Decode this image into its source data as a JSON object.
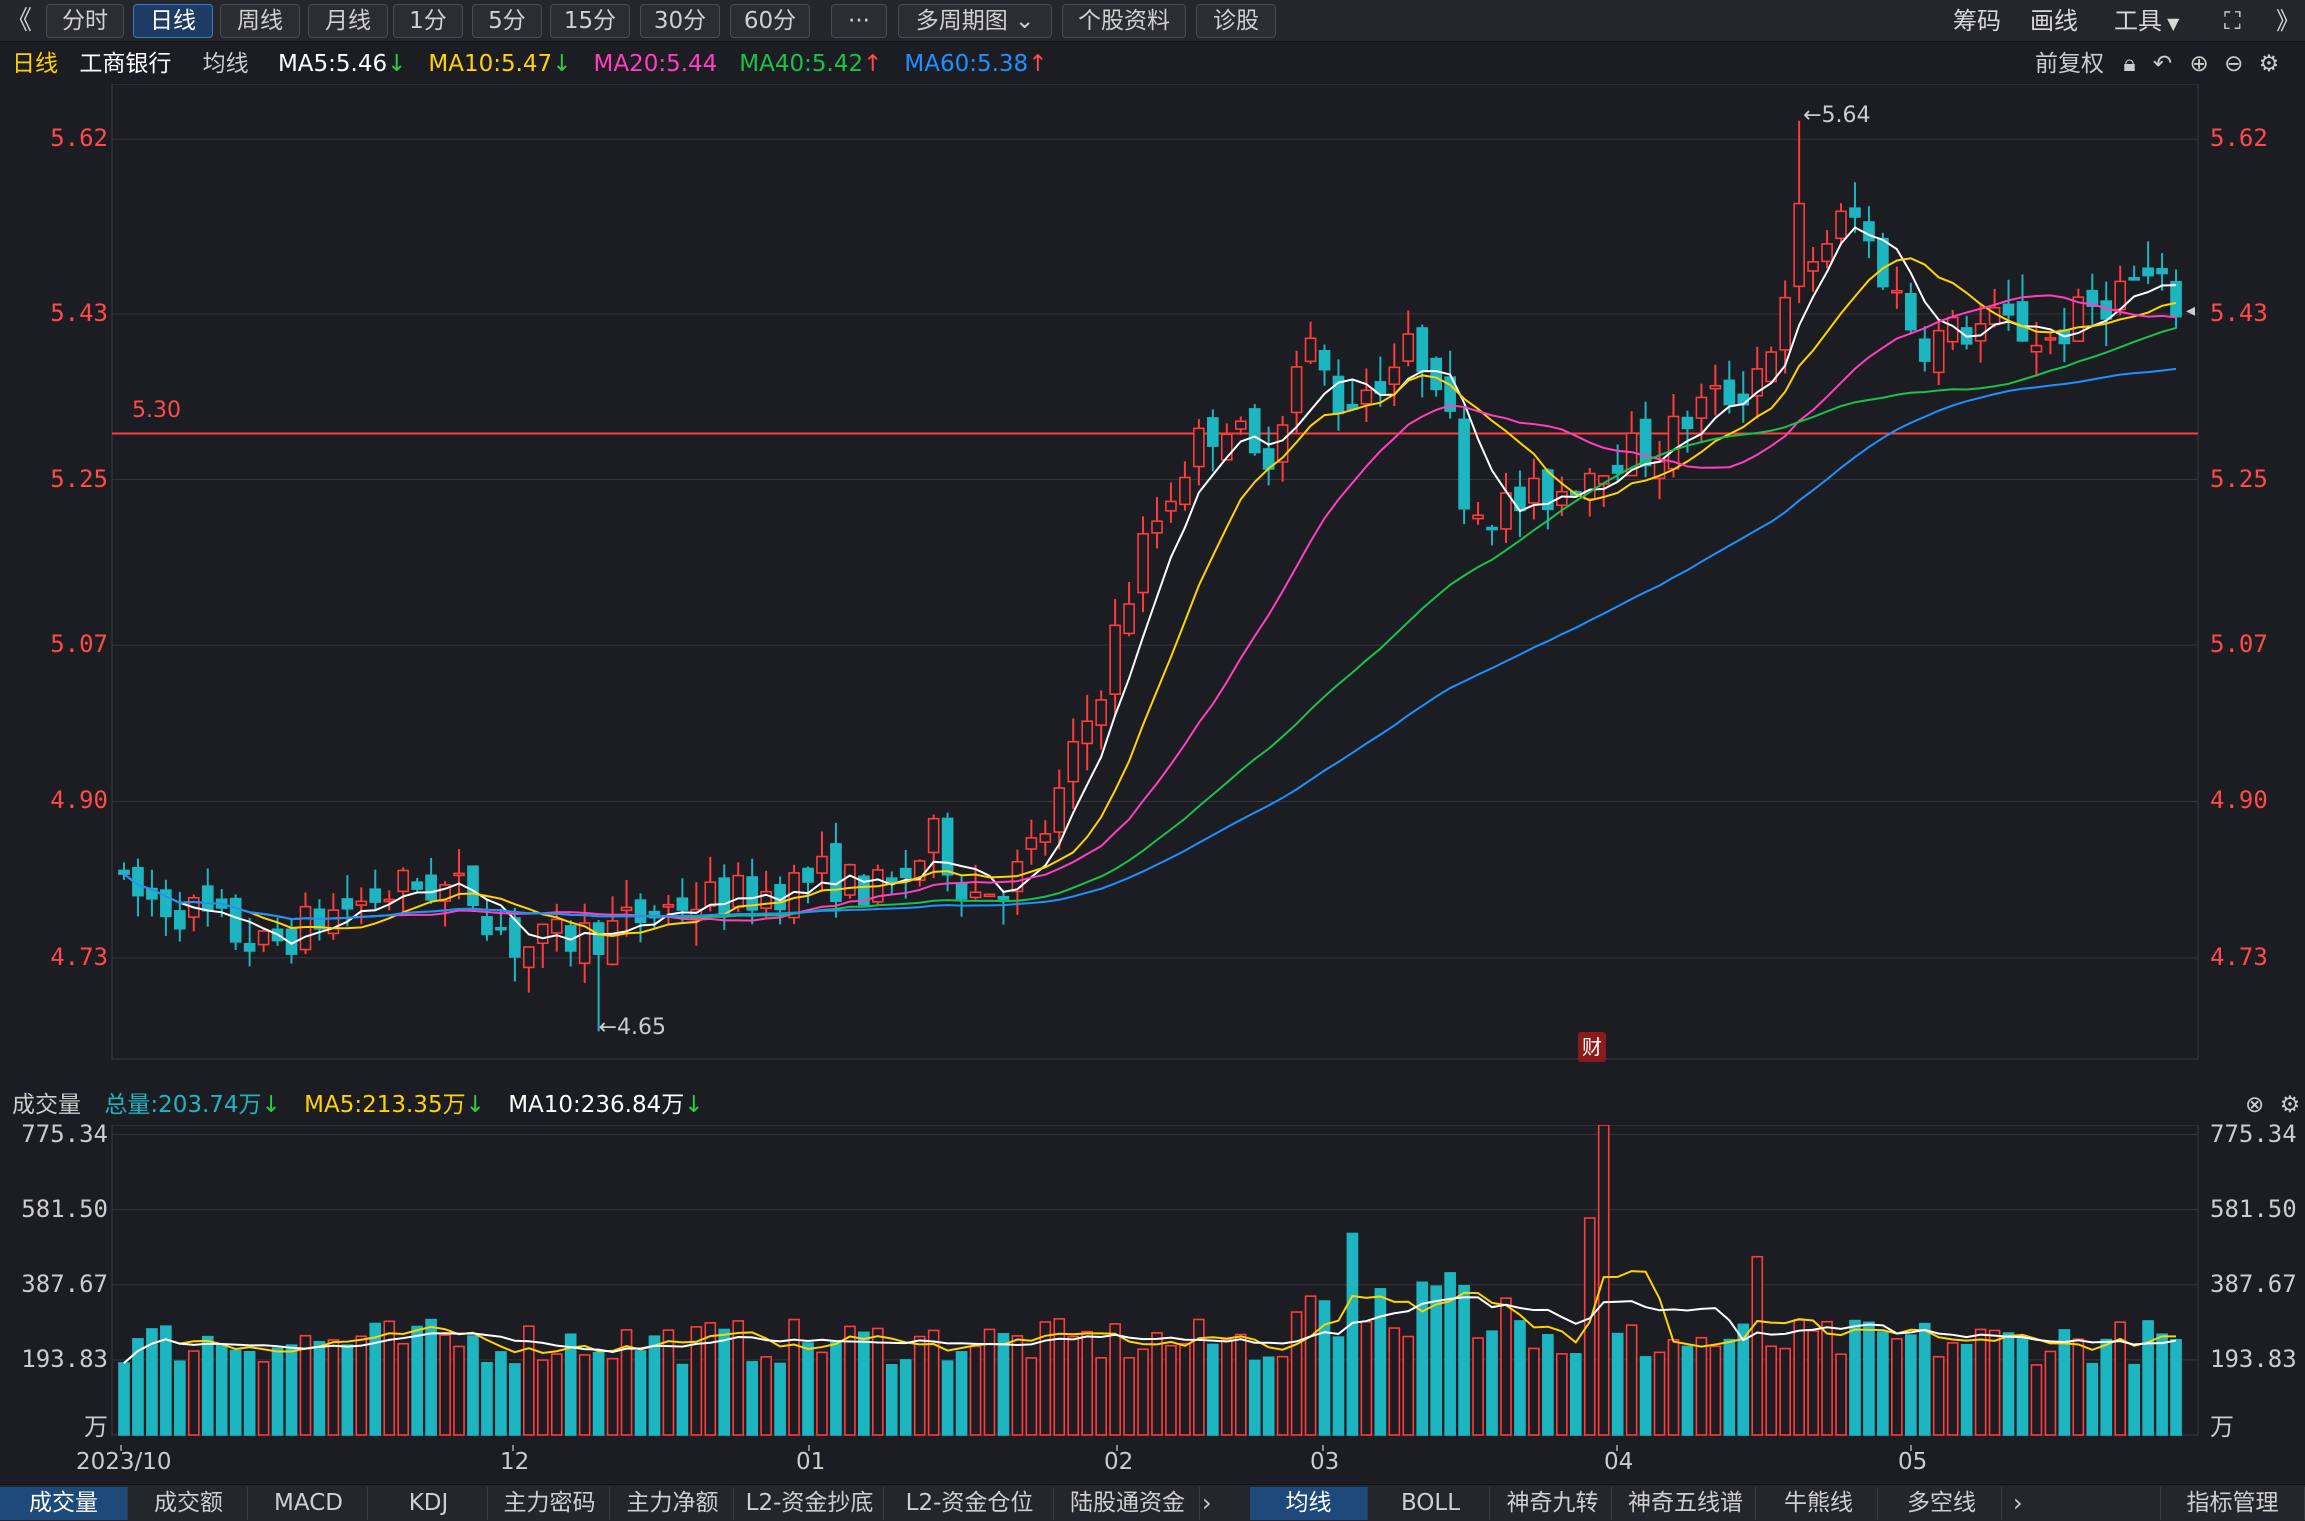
{
  "toolbar": {
    "back": "《",
    "buttons": [
      "分时",
      "日线",
      "周线",
      "月线",
      "1分",
      "5分",
      "15分",
      "30分",
      "60分",
      "···",
      "多周期图",
      "个股资料",
      "诊股"
    ],
    "active": 1,
    "right": [
      "筹码",
      "画线",
      "工具"
    ],
    "fullscreen": "⛶",
    "more": "》"
  },
  "header": {
    "period": "日线",
    "stock": "工商银行",
    "ma_label": "均线",
    "ma": [
      {
        "label": "MA5:5.46",
        "dir": "↓",
        "color": "#ffffff"
      },
      {
        "label": "MA10:5.47",
        "dir": "↓",
        "color": "#ffd200"
      },
      {
        "label": "MA20:5.44",
        "dir": "",
        "color": "#ff3fbf"
      },
      {
        "label": "MA40:5.42",
        "dir": "↑",
        "color": "#18c24b"
      },
      {
        "label": "MA60:5.38",
        "dir": "↑",
        "color": "#1e90ff"
      }
    ],
    "adjust": "前复权"
  },
  "price_axis": {
    "ticks": [
      "5.62",
      "5.43",
      "5.25",
      "5.07",
      "4.90",
      "4.73"
    ]
  },
  "annotations": {
    "high": "←5.64",
    "low": "←4.65",
    "line": "5.30",
    "fin_badge": "财"
  },
  "volume_header": {
    "title": "成交量",
    "total": "总量:203.74万",
    "ma5": "MA5:213.35万",
    "ma10": "MA10:236.84万"
  },
  "volume_axis": {
    "ticks": [
      "775.34",
      "581.50",
      "387.67",
      "193.83"
    ],
    "unit": "万"
  },
  "date_axis": [
    "2023/10",
    "12",
    "01",
    "02",
    "03",
    "04",
    "05"
  ],
  "bottom_tabs_left": [
    "成交量",
    "成交额",
    "MACD",
    "KDJ",
    "主力密码",
    "主力净额",
    "L2-资金抄底",
    "L2-资金仓位",
    "陆股通资金"
  ],
  "bottom_tabs_right": [
    "均线",
    "BOLL",
    "神奇九转",
    "神奇五线谱",
    "牛熊线",
    "多空线"
  ],
  "bottom_manage": "指标管理",
  "colors": {
    "up": "#ff3b3b",
    "down": "#1cb5c0",
    "ma5": "#ffffff",
    "ma10": "#ffd200",
    "ma20": "#ff3fbf",
    "ma40": "#18c24b",
    "ma60": "#1e90ff"
  },
  "chart_data": {
    "type": "candlestick",
    "symbol": "工商银行",
    "period": "daily",
    "ylim": [
      4.62,
      5.68
    ],
    "xlabels": [
      "2023/10",
      "12",
      "01",
      "02",
      "03",
      "04",
      "05"
    ],
    "horizontal_line": 5.3,
    "high": 5.64,
    "low": 4.65,
    "volume_ylim": [
      0,
      800
    ],
    "volume_unit": "万",
    "ma_last": {
      "MA5": 5.46,
      "MA10": 5.47,
      "MA20": 5.44,
      "MA40": 5.42,
      "MA60": 5.38
    },
    "volume_last": {
      "total": 203.74,
      "MA5": 213.35,
      "MA10": 236.84
    }
  }
}
